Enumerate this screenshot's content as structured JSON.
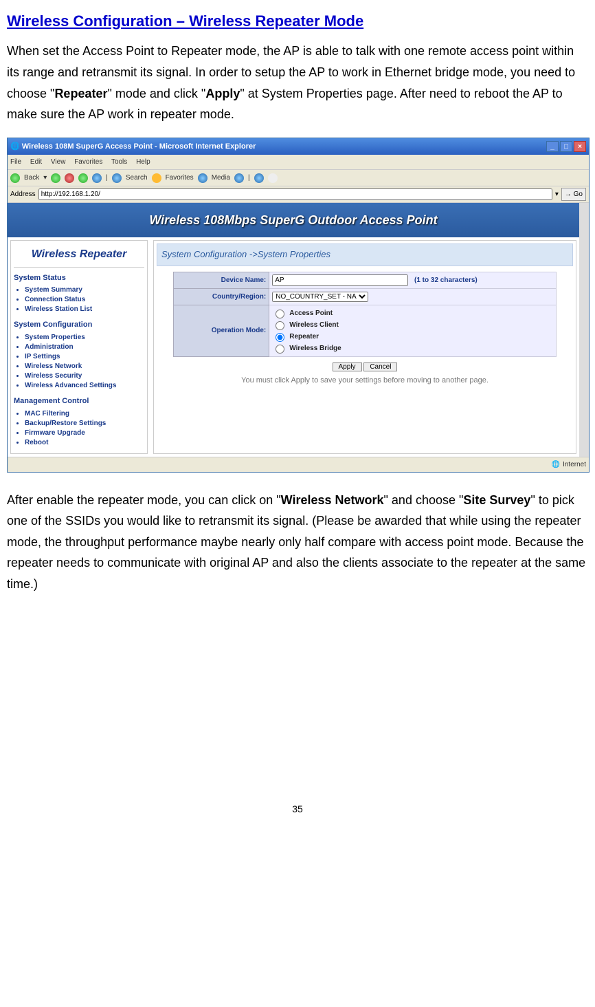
{
  "title": "Wireless Configuration – Wireless Repeater Mode",
  "para1_a": "When set the Access Point to Repeater mode, the AP is able to talk with one remote access point within its range and retransmit its signal. In order to setup the AP to work in Ethernet bridge mode, you need to choose \"",
  "para1_bold1": "Repeater",
  "para1_b": "\" mode and click \"",
  "para1_bold2": "Apply",
  "para1_c": "\" at System Properties page. After need to reboot the AP to make sure the AP work in repeater mode.",
  "para2_a": "After enable the repeater mode, you can click on \"",
  "para2_bold1": "Wireless Network",
  "para2_b": "\" and choose \"",
  "para2_bold2": "Site Survey",
  "para2_c": "\" to pick one of the SSIDs you would like to retransmit its signal. (Please be awarded that while using the repeater mode, the throughput performance maybe nearly only half compare with access point mode. Because the repeater needs to communicate with original AP and also the clients associate to the repeater at the same time.)",
  "page_num": "35",
  "shot": {
    "win_title": "Wireless 108M SuperG Access Point - Microsoft Internet Explorer",
    "menu": [
      "File",
      "Edit",
      "View",
      "Favorites",
      "Tools",
      "Help"
    ],
    "toolbar": {
      "back": "Back",
      "search": "Search",
      "favorites": "Favorites",
      "media": "Media"
    },
    "address_label": "Address",
    "url": "http://192.168.1.20/",
    "go": "Go",
    "banner": "Wireless 108Mbps SuperG Outdoor Access Point",
    "sidebar_title": "Wireless Repeater",
    "groups": [
      {
        "head": "System Status",
        "items": [
          "System Summary",
          "Connection Status",
          "Wireless Station List"
        ]
      },
      {
        "head": "System Configuration",
        "items": [
          "System Properties",
          "Administration",
          "IP Settings",
          "Wireless Network",
          "Wireless Security",
          "Wireless Advanced Settings"
        ]
      },
      {
        "head": "Management Control",
        "items": [
          "MAC Filtering",
          "Backup/Restore Settings",
          "Firmware Upgrade",
          "Reboot"
        ]
      }
    ],
    "crumb": "System Configuration ->System Properties",
    "rows": {
      "device_label": "Device Name:",
      "device_value": "AP",
      "device_hint": "(1 to 32 characters)",
      "country_label": "Country/Region:",
      "country_value": "NO_COUNTRY_SET - NA",
      "op_label": "Operation Mode:",
      "ops": [
        "Access Point",
        "Wireless Client",
        "Repeater",
        "Wireless Bridge"
      ],
      "op_selected": "Repeater"
    },
    "apply": "Apply",
    "cancel": "Cancel",
    "note": "You must click Apply to save your settings before moving to another page.",
    "status": "Internet"
  }
}
